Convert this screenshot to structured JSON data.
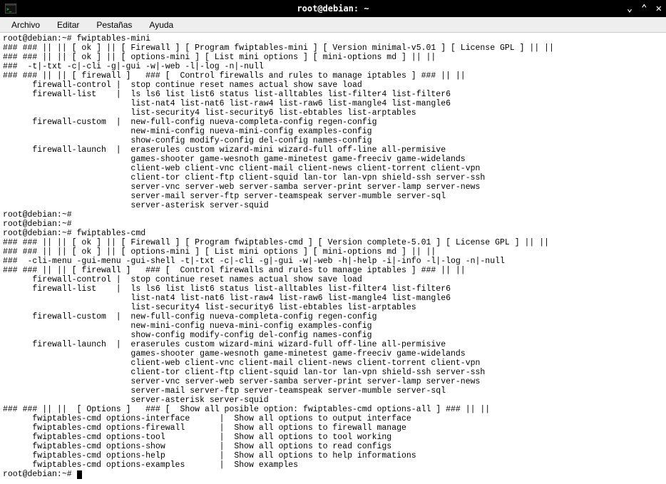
{
  "window": {
    "title": "root@debian: ~"
  },
  "menubar": {
    "items": [
      {
        "label": "Archivo"
      },
      {
        "label": "Editar"
      },
      {
        "label": "Pestañas"
      },
      {
        "label": "Ayuda"
      }
    ]
  },
  "terminal": {
    "prompt1": "root@debian:~# ",
    "cmd1": "fwiptables-mini",
    "line2": "### ### || || [ ok ] || [ Firewall ] [ Program fwiptables-mini ] [ Version minimal-v5.01 ] [ License GPL ] || ||",
    "line3": "### ### || || [ ok ] || [ options-mini ] [ List mini options ] [ mini-options md ] || ||",
    "line4": "###  -t|-txt -c|-cli -g|-gui -w|-web -l|-log -n|-null",
    "line5": "### ### || || [ firewall ]   ### [  Control firewalls and rules to manage iptables ] ### || ||",
    "line6": "      firewall-control |  stop continue reset names actual show save load",
    "line7": "      firewall-list    |  ls ls6 list list6 status list-alltables list-filter4 list-filter6",
    "line8": "                          list-nat4 list-nat6 list-raw4 list-raw6 list-mangle4 list-mangle6",
    "line9": "                          list-security4 list-security6 list-ebtables list-arptables",
    "line10": "      firewall-custom  |  new-full-config nueva-completa-config regen-config",
    "line11": "                          new-mini-config nueva-mini-config examples-config",
    "line12": "                          show-config modify-config del-config names-config",
    "line13": "      firewall-launch  |  eraserules custom wizard-mini wizard-full off-line all-permisive",
    "line14": "                          games-shooter game-wesnoth game-minetest game-freeciv game-widelands",
    "line15": "                          client-web client-vnc client-mail client-news client-torrent client-vpn",
    "line16": "                          client-tor client-ftp client-squid lan-tor lan-vpn shield-ssh server-ssh",
    "line17": "                          server-vnc server-web server-samba server-print server-lamp server-news",
    "line18": "                          server-mail server-ftp server-teamspeak server-mumble server-sql",
    "line19": "                          server-asterisk server-squid",
    "prompt2": "root@debian:~#",
    "prompt3": "root@debian:~#",
    "prompt4": "root@debian:~# ",
    "cmd2": "fwiptables-cmd",
    "line22": "### ### || || [ ok ] || [ Firewall ] [ Program fwiptables-cmd ] [ Version complete-5.01 ] [ License GPL ] || ||",
    "line23": "### ### || || [ ok ] || [ options-mini ] [ List mini options ] [ mini-options md ] || ||",
    "line24": "###  -cli-menu -gui-menu -gui-shell -t|-txt -c|-cli -g|-gui -w|-web -h|-help -i|-info -l|-log -n|-null",
    "line25": "### ### || || [ firewall ]   ### [  Control firewalls and rules to manage iptables ] ### || ||",
    "line26": "      firewall-control |  stop continue reset names actual show save load",
    "line27": "      firewall-list    |  ls ls6 list list6 status list-alltables list-filter4 list-filter6",
    "line28": "                          list-nat4 list-nat6 list-raw4 list-raw6 list-mangle4 list-mangle6",
    "line29": "                          list-security4 list-security6 list-ebtables list-arptables",
    "line30": "      firewall-custom  |  new-full-config nueva-completa-config regen-config",
    "line31": "                          new-mini-config nueva-mini-config examples-config",
    "line32": "                          show-config modify-config del-config names-config",
    "line33": "      firewall-launch  |  eraserules custom wizard-mini wizard-full off-line all-permisive",
    "line34": "                          games-shooter game-wesnoth game-minetest game-freeciv game-widelands",
    "line35": "                          client-web client-vnc client-mail client-news client-torrent client-vpn",
    "line36": "                          client-tor client-ftp client-squid lan-tor lan-vpn shield-ssh server-ssh",
    "line37": "                          server-vnc server-web server-samba server-print server-lamp server-news",
    "line38": "                          server-mail server-ftp server-teamspeak server-mumble server-sql",
    "line39": "                          server-asterisk server-squid",
    "line40": "### ### || ||  [ Options ]   ### [  Show all posible option: fwiptables-cmd options-all ] ### || ||",
    "line41": "      fwiptables-cmd options-interface      |  Show all options to output interface",
    "line42": "      fwiptables-cmd options-firewall       |  Show all options to firewall manage",
    "line43": "      fwiptables-cmd options-tool           |  Show all options to tool working",
    "line44": "      fwiptables-cmd options-show           |  Show all options to read configs",
    "line45": "      fwiptables-cmd options-help           |  Show all options to help informations",
    "line46": "      fwiptables-cmd options-examples       |  Show examples",
    "prompt5": "root@debian:~# "
  }
}
